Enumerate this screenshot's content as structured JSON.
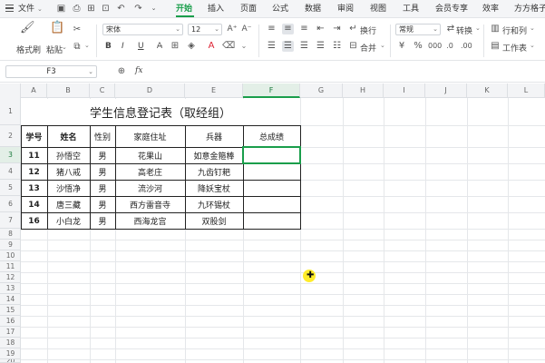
{
  "menubar": {
    "file_label": "文件",
    "tabs": [
      {
        "label": "开始",
        "active": true
      },
      {
        "label": "插入"
      },
      {
        "label": "页面"
      },
      {
        "label": "公式"
      },
      {
        "label": "数据"
      },
      {
        "label": "审阅"
      },
      {
        "label": "视图"
      },
      {
        "label": "工具"
      },
      {
        "label": "会员专享"
      },
      {
        "label": "效率"
      },
      {
        "label": "方方格子"
      }
    ],
    "accent_color": "#1a9e4b"
  },
  "ribbon": {
    "format_painter": "格式刷",
    "paste": "粘贴",
    "font_name": "宋体",
    "font_size": "12",
    "bold": "B",
    "italic": "I",
    "underline": "U",
    "wrap": "换行",
    "merge": "合并",
    "number_format": "常规",
    "convert": "转换",
    "rows_cols": "行和列",
    "worksheet": "工作表"
  },
  "formula_bar": {
    "name_box": "F3",
    "fx_label": "fx",
    "value": ""
  },
  "columns": [
    "A",
    "B",
    "C",
    "D",
    "E",
    "F",
    "G",
    "H",
    "I",
    "J",
    "K",
    "L"
  ],
  "selected_column": "F",
  "rows": [
    "1",
    "2",
    "3",
    "4",
    "5",
    "6",
    "7",
    "8",
    "9",
    "10",
    "11",
    "12",
    "13",
    "14",
    "15",
    "16",
    "17",
    "18",
    "19",
    "20"
  ],
  "selected_row": "3",
  "sheet": {
    "title": "学生信息登记表（取经组）",
    "headers": [
      "学号",
      "姓名",
      "性别",
      "家庭住址",
      "兵器",
      "总成绩"
    ],
    "records": [
      [
        "11",
        "孙悟空",
        "男",
        "花果山",
        "如意金箍棒",
        ""
      ],
      [
        "12",
        "猪八戒",
        "男",
        "高老庄",
        "九齿钉耙",
        ""
      ],
      [
        "13",
        "沙悟净",
        "男",
        "流沙河",
        "降妖宝杖",
        ""
      ],
      [
        "14",
        "唐三藏",
        "男",
        "西方雷音寺",
        "九环锡杖",
        ""
      ],
      [
        "16",
        "小白龙",
        "男",
        "西海龙宫",
        "双股剑",
        ""
      ]
    ]
  }
}
